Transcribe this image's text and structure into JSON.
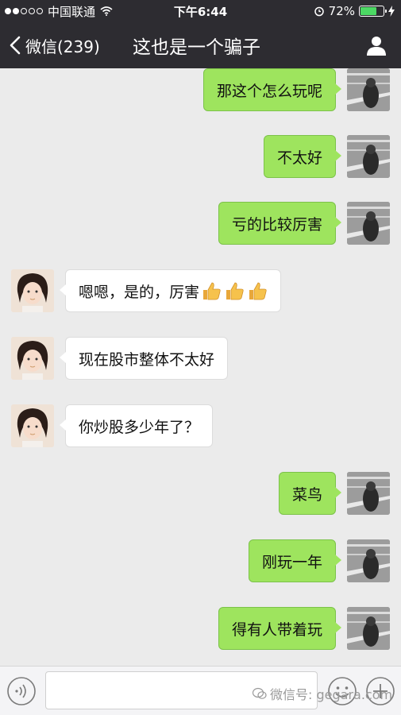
{
  "status_bar": {
    "carrier": "中国联通",
    "time": "下午6:44",
    "battery": "72%",
    "battery_level": 0.72
  },
  "nav": {
    "back_label": "微信(239)",
    "title": "这也是一个骗子"
  },
  "messages": [
    {
      "sender": "self",
      "text": "那这个怎么玩呢"
    },
    {
      "sender": "self",
      "text": "不太好"
    },
    {
      "sender": "self",
      "text": "亏的比较厉害"
    },
    {
      "sender": "other",
      "text": "嗯嗯，是的，厉害",
      "emoji": [
        "thumbs-up",
        "thumbs-up",
        "thumbs-up"
      ]
    },
    {
      "sender": "other",
      "text": "现在股市整体不太好"
    },
    {
      "sender": "other",
      "text": "你炒股多少年了？"
    },
    {
      "sender": "self",
      "text": "菜鸟"
    },
    {
      "sender": "self",
      "text": "刚玩一年"
    },
    {
      "sender": "self",
      "text": "得有人带着玩"
    }
  ],
  "input_bar": {
    "placeholder": ""
  },
  "watermark": "微信号: gegara.com",
  "colors": {
    "header_bg": "#2d2c31",
    "chat_bg": "#ebebeb",
    "outgoing_bubble": "#9ee45e",
    "incoming_bubble": "#ffffff"
  }
}
